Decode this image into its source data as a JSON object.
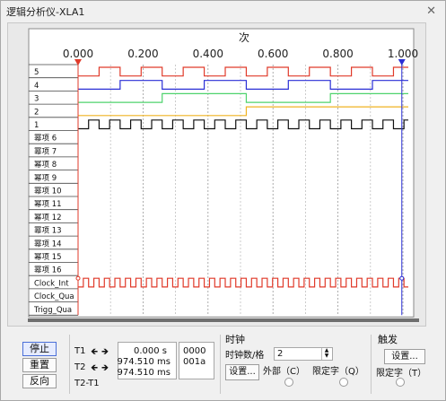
{
  "window": {
    "title": "逻辑分析仪-XLA1"
  },
  "plot": {
    "x_axis_label": "次",
    "ticks": [
      "0.000",
      "0.200",
      "0.400",
      "0.600",
      "0.800",
      "1.000"
    ],
    "channels": [
      "5",
      "4",
      "3",
      "2",
      "1",
      "幂项 6",
      "幂项 7",
      "幂项 8",
      "幂项 9",
      "幂项 10",
      "幂项 11",
      "幂项 12",
      "幂项 13",
      "幂项 14",
      "幂项 15",
      "幂项 16",
      "Clock_Int",
      "Clock_Qua",
      "Trigg_Qua"
    ],
    "colors": {
      "ch5": "#e03a2a",
      "ch4": "#2a2fd6",
      "ch3": "#4ed36c",
      "ch2": "#f0b322",
      "ch1": "#111111",
      "clock": "#e03a2a",
      "cursor1": "#e03a2a",
      "cursor2": "#2a2fd6"
    },
    "waveforms": {
      "ch5": [
        0,
        1,
        0,
        1,
        0,
        1,
        0,
        1,
        0,
        1,
        0,
        1,
        0,
        1,
        0,
        1
      ],
      "ch4": [
        0,
        0,
        1,
        1,
        0,
        0,
        1,
        1,
        0,
        0,
        1,
        1,
        0,
        0,
        1,
        1
      ],
      "ch3": [
        0,
        0,
        0,
        0,
        1,
        1,
        1,
        1,
        0,
        0,
        0,
        0,
        1,
        1,
        1,
        1
      ],
      "ch2": [
        0,
        0,
        0,
        0,
        0,
        0,
        0,
        0,
        1,
        1,
        1,
        1,
        1,
        1,
        1,
        1
      ]
    }
  },
  "controls": {
    "buttons": [
      "停止",
      "重置",
      "反向"
    ],
    "cursors": {
      "t1_label": "T1",
      "t2_label": "T2",
      "t2t1_label": "T2-T1",
      "t1_time": "0.000 s",
      "t2_time": "974.510 ms",
      "t2t1_time": "974.510 ms",
      "t1_value": "0000",
      "t2_value": "001a"
    },
    "clock": {
      "section_label": "时钟",
      "per_div_label": "时钟数/格",
      "per_div_value": "2",
      "settings_button": "设置...",
      "external_label": "外部（C）",
      "qualifier_label": "限定字（Q）"
    },
    "trigger": {
      "section_label": "触发",
      "settings_button": "设置...",
      "qualifier_label": "限定字（T）"
    }
  }
}
